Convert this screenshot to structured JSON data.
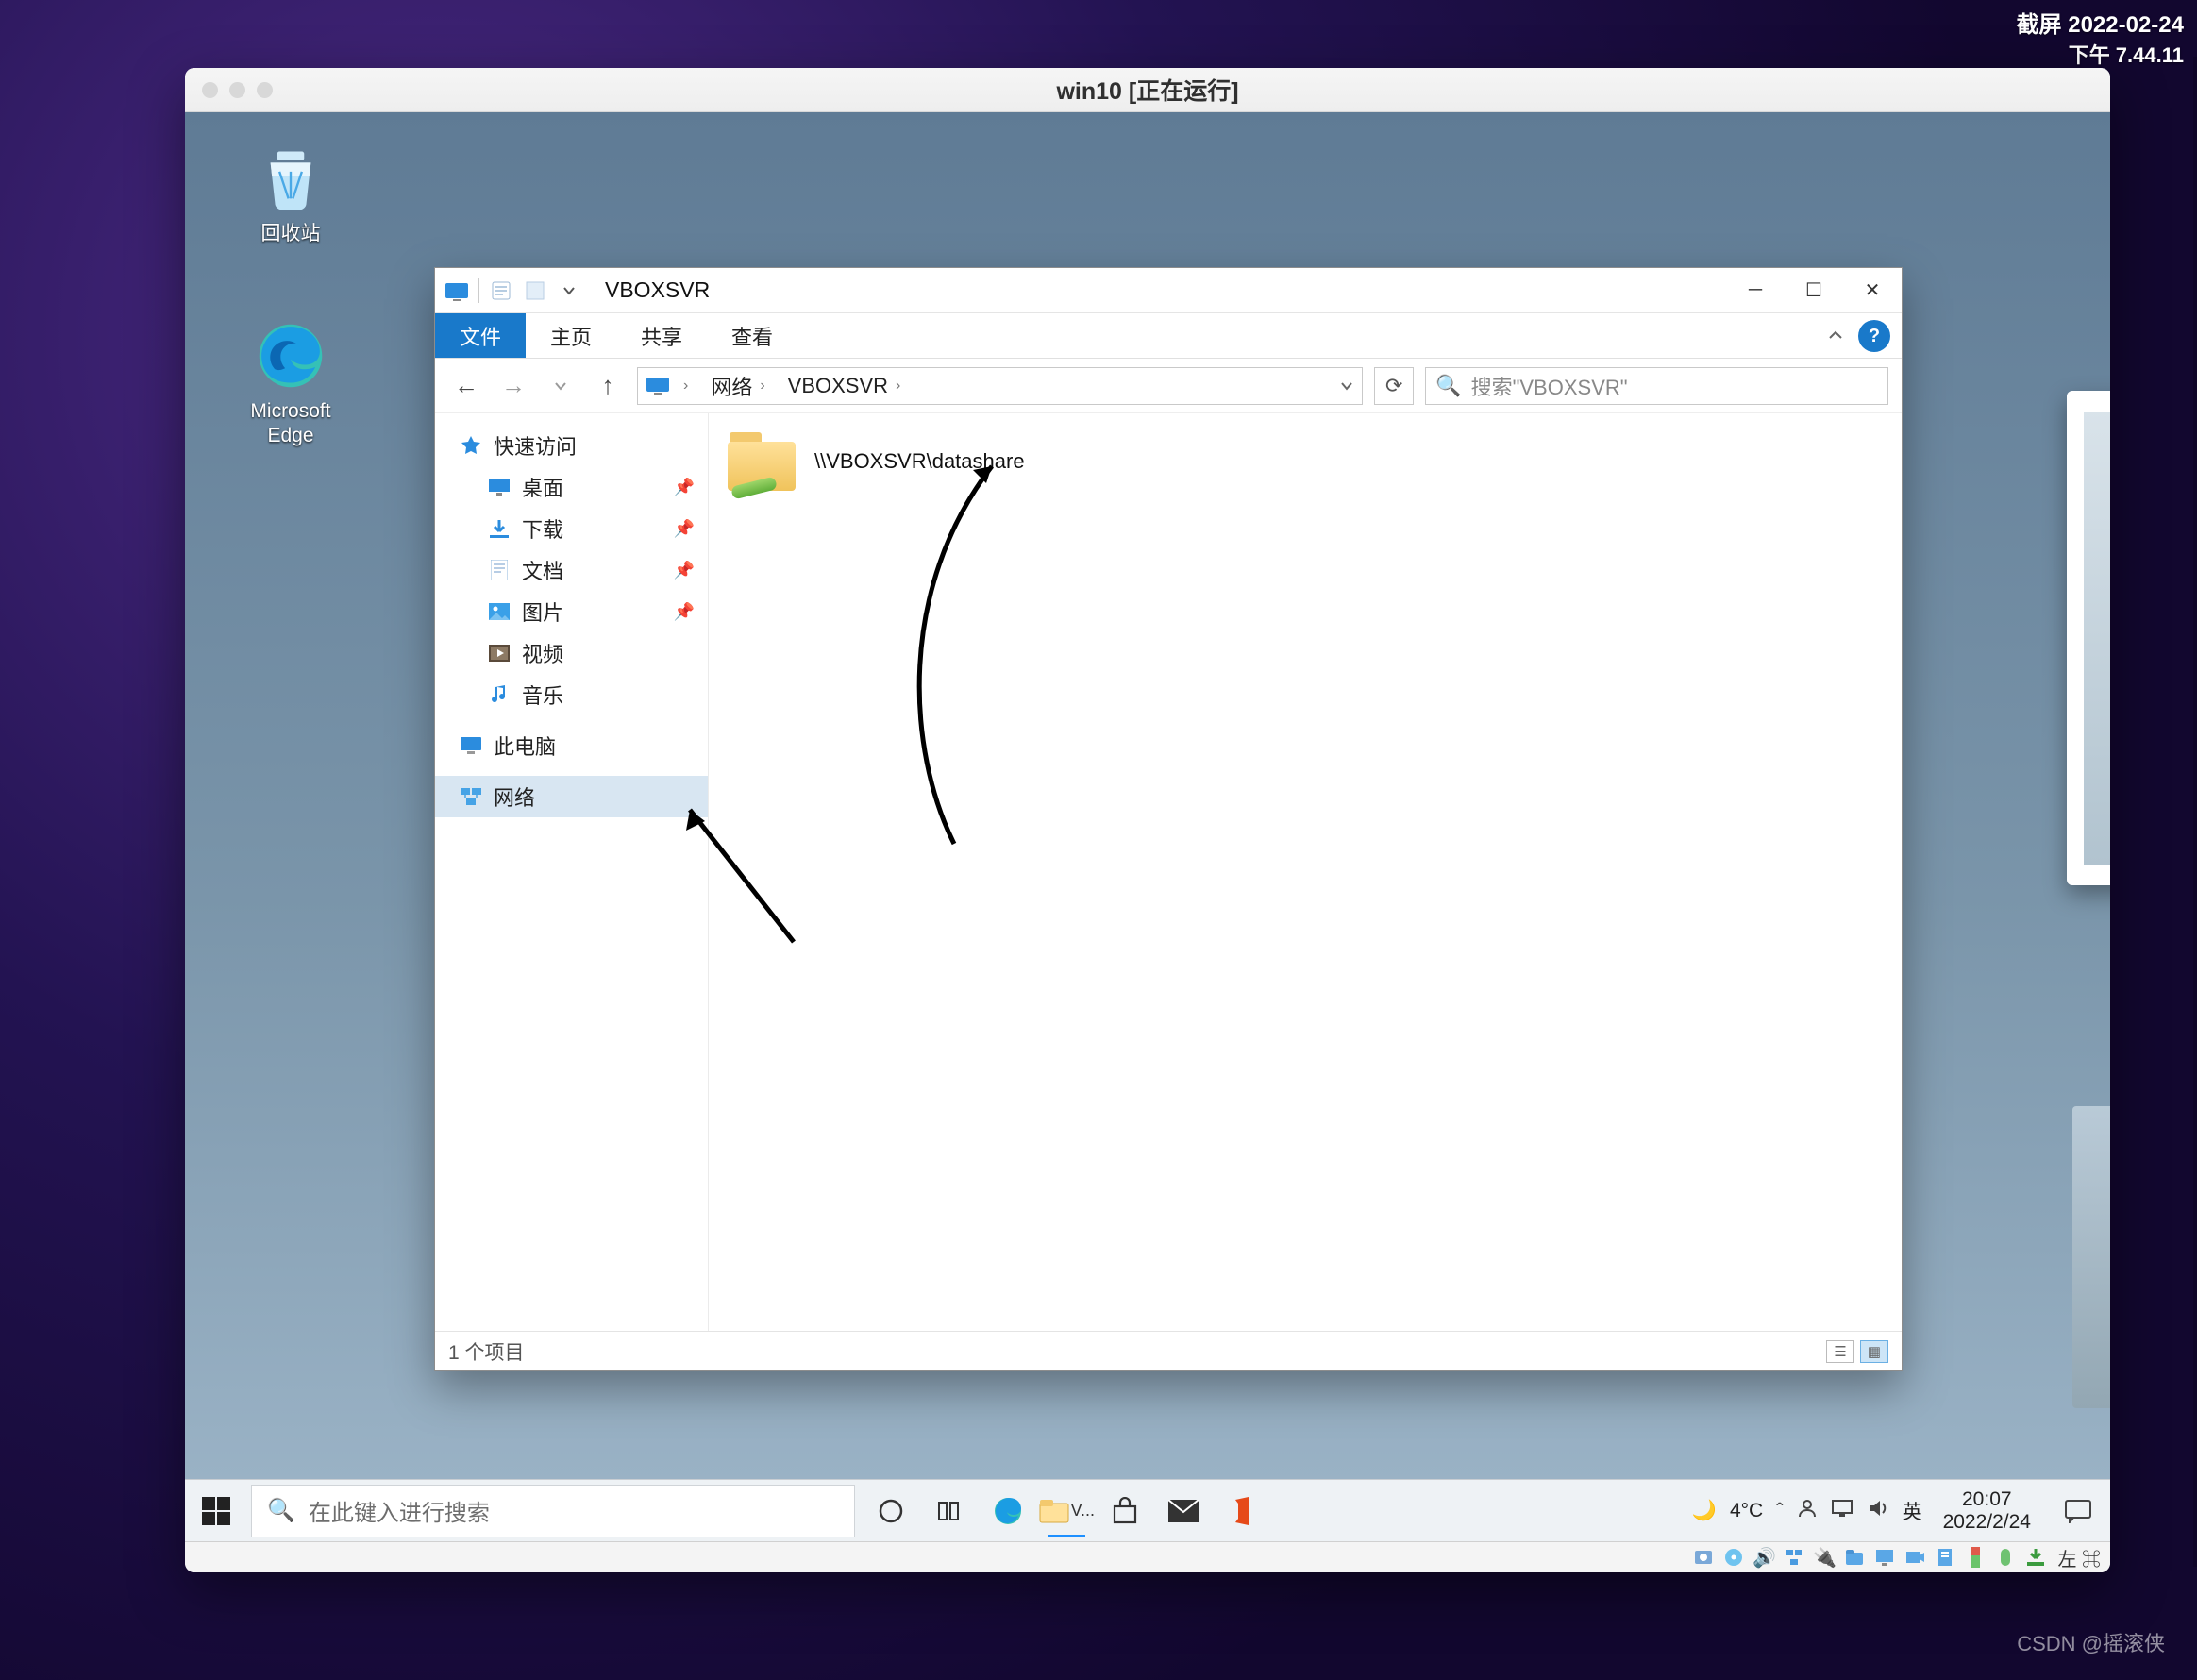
{
  "host_overlay": {
    "line1": "截屏 2022-02-24",
    "line2": "下午 7.44.11"
  },
  "csdn_watermark": "CSDN @摇滚侠",
  "vm": {
    "title": "win10 [正在运行]",
    "host_capture_key": "左 ⌘"
  },
  "desktop_icons": [
    {
      "label": "回收站",
      "id": "recycle-bin"
    },
    {
      "label": "Microsoft Edge",
      "id": "edge"
    }
  ],
  "explorer": {
    "title": "VBOXSVR",
    "ribbon_tabs": [
      {
        "id": "file",
        "label": "文件",
        "active": true
      },
      {
        "id": "home",
        "label": "主页"
      },
      {
        "id": "share",
        "label": "共享"
      },
      {
        "id": "view",
        "label": "查看"
      }
    ],
    "breadcrumb": [
      {
        "label": "网络"
      },
      {
        "label": "VBOXSVR"
      }
    ],
    "search_placeholder": "搜索\"VBOXSVR\"",
    "sidebar": {
      "quick_access": "快速访问",
      "items": [
        {
          "label": "桌面",
          "pinned": true
        },
        {
          "label": "下载",
          "pinned": true
        },
        {
          "label": "文档",
          "pinned": true
        },
        {
          "label": "图片",
          "pinned": true
        },
        {
          "label": "视频"
        },
        {
          "label": "音乐"
        }
      ],
      "this_pc": "此电脑",
      "network": "网络"
    },
    "content_items": [
      {
        "label": "\\\\VBOXSVR\\datashare"
      }
    ],
    "status": "1 个项目"
  },
  "taskbar": {
    "search_placeholder": "在此键入进行搜索",
    "running_label": "V...",
    "weather": "4°C",
    "ime": "英",
    "clock": {
      "time": "20:07",
      "date": "2022/2/24"
    }
  },
  "colors": {
    "accent": "#1979ca"
  }
}
